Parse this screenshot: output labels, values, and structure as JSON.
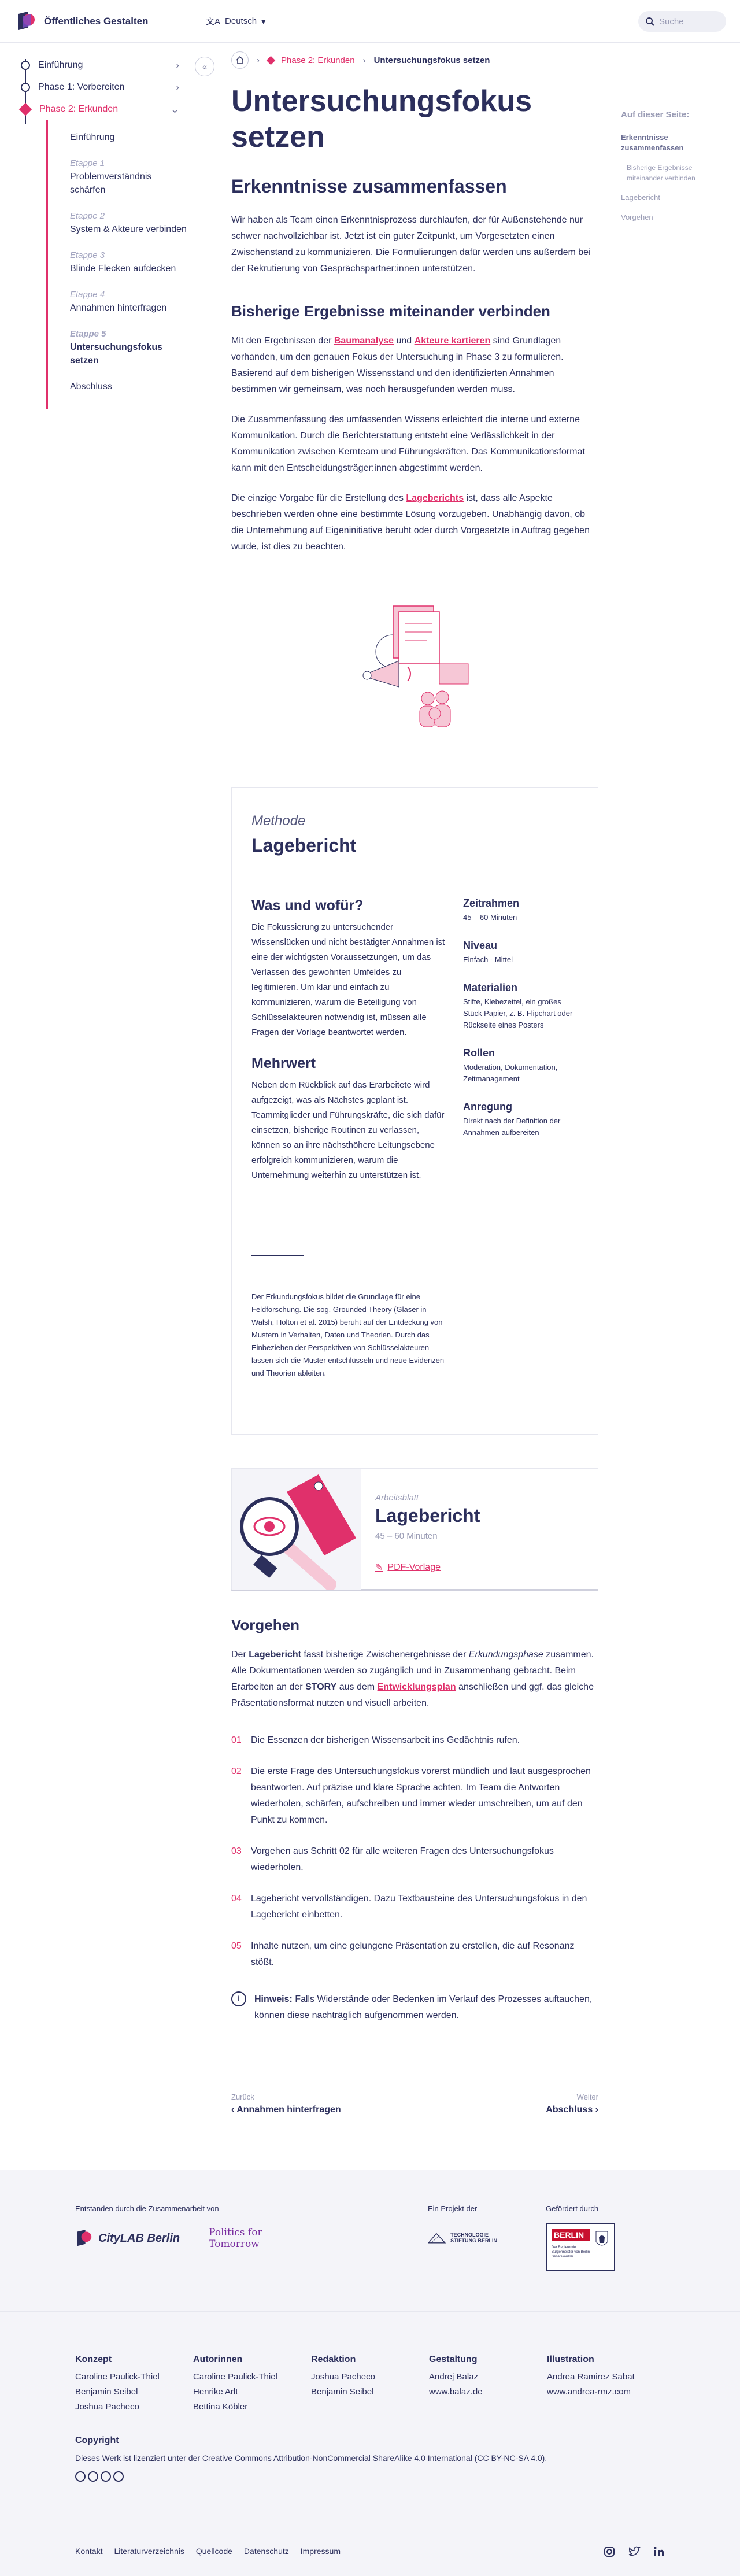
{
  "header": {
    "site_title": "Öffentliches Gestalten",
    "language": "Deutsch",
    "search_placeholder": "Suche"
  },
  "sidebar": {
    "items": [
      {
        "label": "Einführung"
      },
      {
        "label": "Phase 1: Vorbereiten"
      },
      {
        "label": "Phase 2: Erkunden"
      }
    ],
    "sub_items": [
      {
        "step": "",
        "label": "Einführung"
      },
      {
        "step": "Etappe 1",
        "label": "Problemverständnis schärfen"
      },
      {
        "step": "Etappe 2",
        "label": "System & Akteure verbinden"
      },
      {
        "step": "Etappe 3",
        "label": "Blinde Flecken aufdecken"
      },
      {
        "step": "Etappe 4",
        "label": "Annahmen hinterfragen"
      },
      {
        "step": "Etappe 5",
        "label": "Untersuchungsfokus setzen"
      },
      {
        "step": "",
        "label": "Abschluss"
      }
    ]
  },
  "breadcrumb": {
    "phase": "Phase 2: Erkunden",
    "current": "Untersuchungsfokus setzen"
  },
  "toc": {
    "title": "Auf dieser Seite:",
    "items": [
      "Erkenntnisse zusammenfassen",
      "Bisherige Ergebnisse miteinander verbinden",
      "Lagebericht",
      "Vorgehen"
    ]
  },
  "content": {
    "title": "Untersuchungsfokus setzen",
    "h2": "Erkenntnisse zusammenfassen",
    "p1": "Wir haben als Team einen Erkenntnisprozess durchlaufen, der für Außenstehende nur schwer nachvollziehbar ist. Jetzt ist ein guter Zeitpunkt, um Vorgesetzten einen Zwischenstand zu kommunizieren. Die Formulierungen dafür werden uns außerdem bei der Rekrutierung von Gesprächspartner:innen unterstützen.",
    "h3": "Bisherige Ergebnisse miteinander verbinden",
    "p2_a": "Mit den Ergebnissen der ",
    "p2_link1": "Baumanalyse",
    "p2_b": " und ",
    "p2_link2": "Akteure kartieren",
    "p2_c": " sind Grundlagen vorhanden, um den genauen Fokus der Untersuchung in Phase 3 zu formulieren. Basierend auf dem bisherigen Wissensstand und den identifizierten Annahmen bestimmen wir gemeinsam, was noch herausgefunden werden muss.",
    "p3": "Die Zusammenfassung des umfassenden Wissens erleichtert die interne und externe Kommunikation. Durch die Berichterstattung entsteht eine Verlässlichkeit in der Kommunikation zwischen Kernteam und Führungskräften. Das Kommunikationsformat kann mit den Entscheidungsträger:innen abgestimmt werden.",
    "p4_a": "Die einzige Vorgabe für die Erstellung des ",
    "p4_link": "Lageberichts",
    "p4_b": " ist, dass alle Aspekte beschrieben werden ohne eine bestimmte Lösung vorzugeben. Unabhängig davon, ob die Unternehmung auf Eigeninitiative beruht oder durch Vorgesetzte in Auftrag gegeben wurde, ist dies zu beachten."
  },
  "method": {
    "type": "Methode",
    "title": "Lagebericht",
    "what_h": "Was und wofür?",
    "what_p": "Die Fokussierung zu untersuchender Wissenslücken und nicht bestätigter Annahmen ist eine der wichtigsten Voraussetzungen, um das Verlassen des gewohnten Umfeldes zu legitimieren. Um klar und einfach zu kommunizieren, warum die Beteiligung von Schlüsselakteuren notwendig ist, müssen alle Fragen der Vorlage beantwortet werden.",
    "value_h": "Mehrwert",
    "value_p": "Neben dem Rückblick auf das Erarbeitete wird aufgezeigt, was als Nächstes geplant ist. Teammitglieder und Führungskräfte, die sich dafür einsetzen, bisherige Routinen zu verlassen, können so an ihre nächsthöhere Leitungsebene erfolgreich kommunizieren, warum die Unternehmung weiterhin zu unterstützen ist.",
    "note": "Der Erkundungsfokus bildet die Grundlage für eine Feldforschung. Die sog. Grounded Theory (Glaser in Walsh, Holton et al. 2015) beruht auf der Entdeckung von Mustern in Verhalten, Daten und Theorien. Durch das Einbeziehen der Perspektiven von Schlüsselakteuren lassen sich die Muster entschlüsseln und neue Evidenzen und Theorien ableiten.",
    "side": [
      {
        "h": "Zeitrahmen",
        "v": "45 – 60 Minuten"
      },
      {
        "h": "Niveau",
        "v": "Einfach - Mittel"
      },
      {
        "h": "Materialien",
        "v": "Stifte, Klebezettel, ein großes Stück Papier, z. B. Flipchart oder Rückseite eines Posters"
      },
      {
        "h": "Rollen",
        "v": "Moderation, Dokumentation, Zeitmanagement"
      },
      {
        "h": "Anregung",
        "v": "Direkt nach der Definition der Annahmen aufbereiten"
      }
    ]
  },
  "worksheet": {
    "label": "Arbeitsblatt",
    "title": "Lagebericht",
    "duration": "45 – 60 Minuten",
    "download": "PDF-Vorlage"
  },
  "procedure": {
    "h": "Vorgehen",
    "intro_b1": "Lagebericht",
    "intro_a": " fasst bisherige Zwischenergebnisse der ",
    "intro_i": "Erkundungsphase",
    "intro_b": " zusammen. Alle Dokumentationen werden so zugänglich und in Zusammenhang gebracht. Beim Erarbeiten an der ",
    "intro_b2": "STORY",
    "intro_c": " aus dem ",
    "intro_link": "Entwicklungsplan",
    "intro_d": " anschließen und ggf. das gleiche Präsentationsformat nutzen und visuell arbeiten.",
    "intro_pre": "Der ",
    "steps": [
      {
        "no": "01",
        "text": "Die Essenzen der bisherigen Wissensarbeit ins Gedächtnis rufen."
      },
      {
        "no": "02",
        "text": "Die erste Frage des Untersuchungsfokus vorerst mündlich und laut ausgesprochen beantworten. Auf präzise und klare Sprache achten. Im Team die Antworten wiederholen, schärfen, aufschreiben und immer wieder umschreiben, um auf den Punkt zu kommen."
      },
      {
        "no": "03",
        "text": "Vorgehen aus Schritt 02 für alle weiteren Fragen des Untersuchungsfokus wiederholen."
      },
      {
        "no": "04",
        "text": "Lagebericht vervollständigen. Dazu Textbausteine des Untersuchungsfokus in den Lagebericht einbetten."
      },
      {
        "no": "05",
        "text": "Inhalte nutzen, um eine gelungene Präsentation zu erstellen, die auf Resonanz stößt."
      }
    ],
    "hint_label": "Hinweis:",
    "hint_text": " Falls Widerstände oder Bedenken im Verlauf des Prozesses auftauchen, können diese nachträglich aufgenommen werden."
  },
  "pager": {
    "prev_label": "Zurück",
    "prev_title": "Annahmen hinterfragen",
    "next_label": "Weiter",
    "next_title": "Abschluss"
  },
  "footer": {
    "created_by": "Entstanden durch die Zusammenarbeit von",
    "citylab": "CityLAB Berlin",
    "pft1": "Politics for",
    "pft2": "Tomorrow",
    "project_of": "Ein Projekt der",
    "tsb": "TECHNOLOGIE STIFTUNG BERLIN",
    "funded_by": "Gefördert durch",
    "berlin": "BERLIN",
    "berlin_sub": "Der Regierende Bürgermeister von Berlin · Senatskanzlei",
    "credits": [
      {
        "h": "Konzept",
        "names": [
          "Caroline Paulick-Thiel",
          "Benjamin Seibel",
          "Joshua Pacheco"
        ]
      },
      {
        "h": "Autorinnen",
        "names": [
          "Caroline Paulick-Thiel",
          "Henrike Arlt",
          "Bettina Köbler"
        ]
      },
      {
        "h": "Redaktion",
        "names": [
          "Joshua Pacheco",
          "Benjamin Seibel"
        ]
      },
      {
        "h": "Gestaltung",
        "names": [
          "Andrej Balaz",
          "www.balaz.de"
        ]
      },
      {
        "h": "Illustration",
        "names": [
          "Andrea Ramirez Sabat",
          "www.andrea-rmz.com"
        ]
      }
    ],
    "copyright_h": "Copyright",
    "copyright_text": "Dieses Werk ist lizenziert unter der Creative Commons Attribution-NonCommercial ShareAlike 4.0 International (CC BY-NC-SA 4.0).",
    "links": [
      "Kontakt",
      "Literaturverzeichnis",
      "Quellcode",
      "Datenschutz",
      "Impressum"
    ]
  },
  "colors": {
    "accent": "#e0306b",
    "text": "#2c2f5c",
    "muted": "#9a9cb5"
  }
}
